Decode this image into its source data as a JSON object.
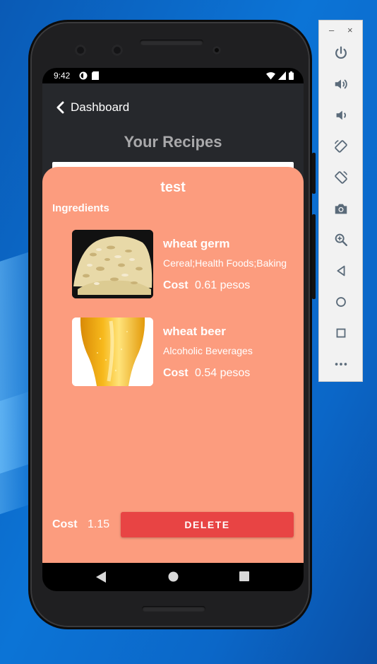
{
  "status_bar": {
    "time": "9:42"
  },
  "header": {
    "back_label": "Dashboard",
    "title": "Your Recipes"
  },
  "recipe": {
    "name": "test",
    "ingredients_heading": "Ingredients",
    "ingredients": [
      {
        "name": "wheat germ",
        "categories": "Cereal;Health Foods;Baking",
        "cost_label": "Cost",
        "cost_value": "0.61 pesos",
        "image": "wheat-germ-photo"
      },
      {
        "name": "wheat beer",
        "categories": "Alcoholic Beverages",
        "cost_label": "Cost",
        "cost_value": "0.54 pesos",
        "image": "wheat-beer-photo"
      }
    ],
    "total_cost_label": "Cost",
    "total_cost_value": "1.15",
    "delete_label": "DELETE"
  },
  "emulator_toolbar": {
    "window_controls": [
      "–",
      "×"
    ],
    "tools": [
      "power-icon",
      "volume-up-icon",
      "volume-down-icon",
      "rotate-left-icon",
      "rotate-right-icon",
      "camera-icon",
      "zoom-icon",
      "back-icon",
      "home-icon",
      "overview-icon",
      "more-icon"
    ]
  },
  "colors": {
    "sheet": "#fc9c7e",
    "delete": "#e84444",
    "screen_bg": "#26282c"
  }
}
